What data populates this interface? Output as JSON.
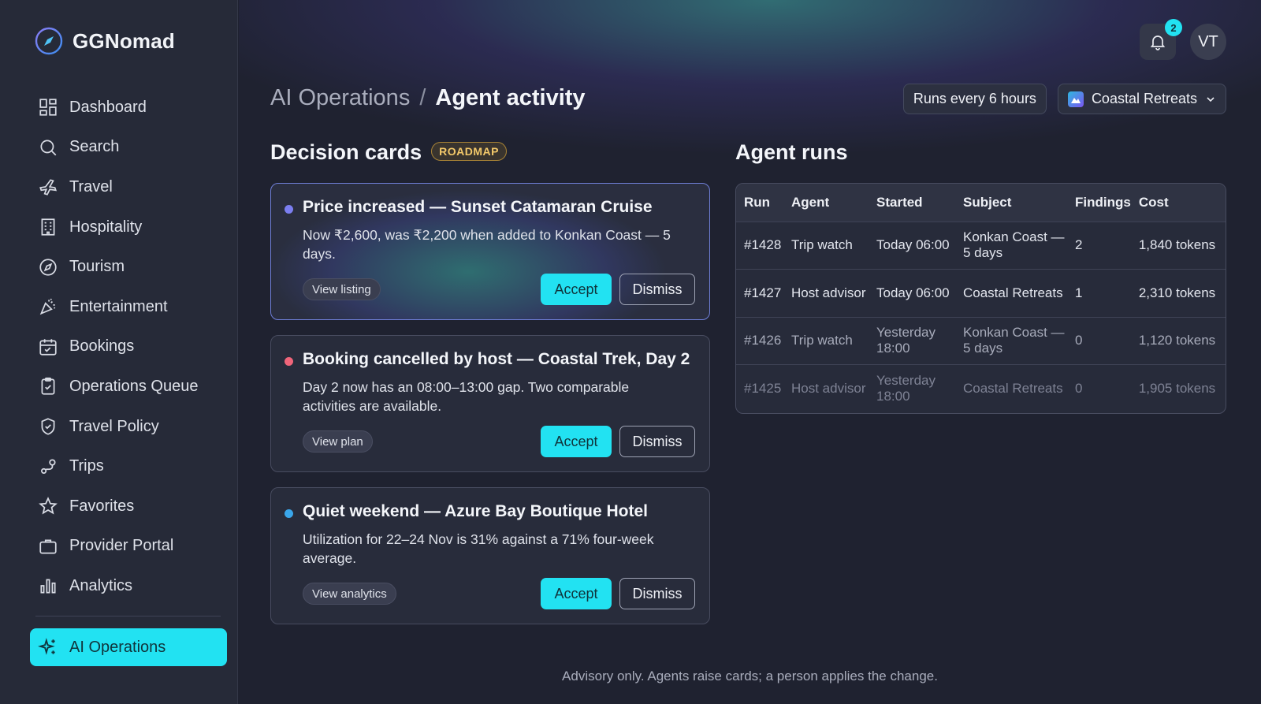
{
  "app": {
    "name": "GGNomad"
  },
  "sidebar": {
    "items": [
      {
        "label": "Dashboard",
        "icon": "dashboard-icon"
      },
      {
        "label": "Search",
        "icon": "search-icon"
      },
      {
        "label": "Travel",
        "icon": "plane-icon"
      },
      {
        "label": "Hospitality",
        "icon": "building-icon"
      },
      {
        "label": "Tourism",
        "icon": "compass-icon"
      },
      {
        "label": "Entertainment",
        "icon": "party-icon"
      },
      {
        "label": "Bookings",
        "icon": "calendar-icon"
      },
      {
        "label": "Operations Queue",
        "icon": "clipboard-icon"
      },
      {
        "label": "Travel Policy",
        "icon": "shield-icon"
      },
      {
        "label": "Trips",
        "icon": "route-icon"
      },
      {
        "label": "Favorites",
        "icon": "star-icon"
      },
      {
        "label": "Provider Portal",
        "icon": "briefcase-icon"
      },
      {
        "label": "Analytics",
        "icon": "bar-chart-icon"
      }
    ],
    "active": {
      "label": "AI Operations",
      "icon": "sparkles-icon"
    }
  },
  "topbar": {
    "notification_count": "2",
    "avatar_initials": "VT"
  },
  "breadcrumb": {
    "parent": "AI Operations",
    "separator": "/",
    "current": "Agent activity"
  },
  "header": {
    "schedule_label": "Runs every 6 hours",
    "provider_label": "Coastal Retreats"
  },
  "decision_cards": {
    "title": "Decision cards",
    "badge": "ROADMAP",
    "cards": [
      {
        "title": "Price increased — Sunset Catamaran Cruise",
        "body": "Now ₹2,600, was ₹2,200 when added to Konkan Coast — 5 days.",
        "link": "View listing",
        "accept": "Accept",
        "dismiss": "Dismiss",
        "dot_color": "#7b7ef0"
      },
      {
        "title": "Booking cancelled by host — Coastal Trek, Day 2",
        "body": "Day 2 now has an 08:00–13:00 gap. Two comparable activities are available.",
        "link": "View plan",
        "accept": "Accept",
        "dismiss": "Dismiss",
        "dot_color": "#f0657a"
      },
      {
        "title": "Quiet weekend — Azure Bay Boutique Hotel",
        "body": "Utilization for 22–24 Nov is 31% against a 71% four-week average.",
        "link": "View analytics",
        "accept": "Accept",
        "dismiss": "Dismiss",
        "dot_color": "#3aa6ea"
      }
    ]
  },
  "agent_runs": {
    "title": "Agent runs",
    "columns": [
      "Run",
      "Agent",
      "Started",
      "Subject",
      "Findings",
      "Cost"
    ],
    "rows": [
      {
        "run": "#1428",
        "agent": "Trip watch",
        "started": "Today 06:00",
        "subject": "Konkan Coast — 5 days",
        "findings": "2",
        "cost": "1,840 tokens"
      },
      {
        "run": "#1427",
        "agent": "Host advisor",
        "started": "Today 06:00",
        "subject": "Coastal Retreats",
        "findings": "1",
        "cost": "2,310 tokens"
      },
      {
        "run": "#1426",
        "agent": "Trip watch",
        "started": "Yesterday 18:00",
        "subject": "Konkan Coast — 5 days",
        "findings": "0",
        "cost": "1,120 tokens"
      },
      {
        "run": "#1425",
        "agent": "Host advisor",
        "started": "Yesterday 18:00",
        "subject": "Coastal Retreats",
        "findings": "0",
        "cost": "1,905 tokens"
      }
    ]
  },
  "footer": {
    "note": "Advisory only. Agents raise cards; a person applies the change."
  },
  "colors": {
    "accent": "#22e2f2",
    "background": "#1f2230",
    "sidebar": "#262a38",
    "badge": "#f3c96a"
  }
}
